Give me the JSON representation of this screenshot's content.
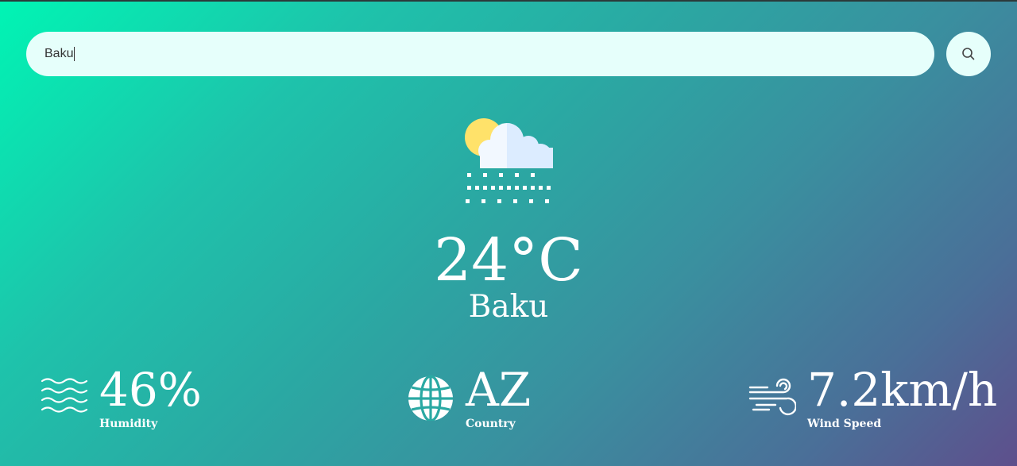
{
  "search": {
    "value": "Baku"
  },
  "weather": {
    "condition_icon": "sun-cloud-snow-icon",
    "temperature": "24°C",
    "city": "Baku"
  },
  "stats": {
    "humidity": {
      "value": "46%",
      "label": "Humidity",
      "icon": "waves-icon"
    },
    "country": {
      "value": "AZ",
      "label": "Country",
      "icon": "globe-icon"
    },
    "wind": {
      "value": "7.2km/h",
      "label": "Wind Speed",
      "icon": "wind-icon"
    }
  },
  "colors": {
    "gradient_start": "#00f5b4",
    "gradient_end": "#5e4f8c",
    "search_bg": "#e6fffb",
    "text": "#ffffff"
  }
}
